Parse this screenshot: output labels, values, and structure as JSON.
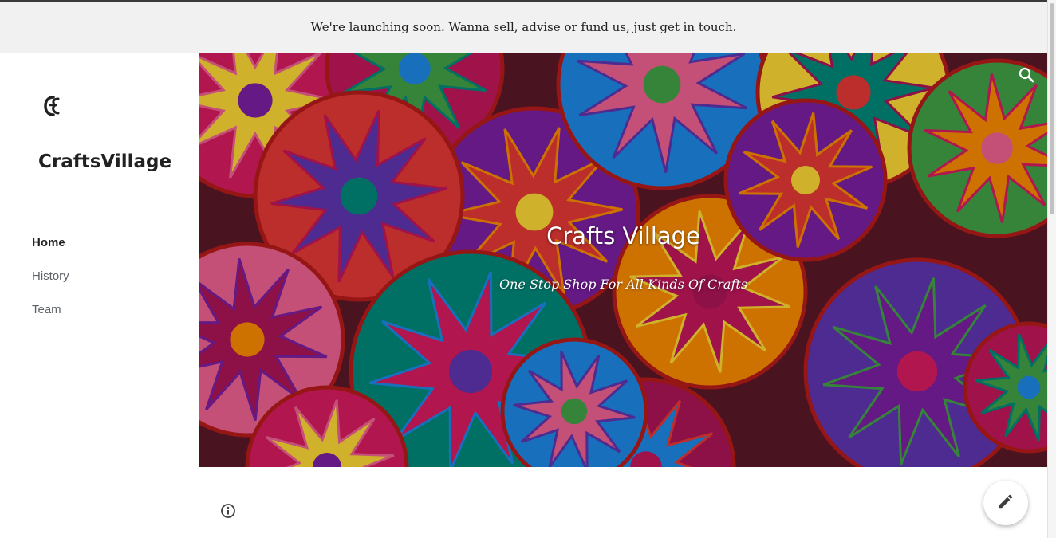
{
  "banner": {
    "text": "We're launching soon. Wanna sell, advise or fund us, just get in touch."
  },
  "sidebar": {
    "site_name": "CraftsVillage",
    "logo_icon": "crafts-village-logo",
    "nav": [
      {
        "label": "Home",
        "active": true
      },
      {
        "label": "History",
        "active": false
      },
      {
        "label": "Team",
        "active": false
      }
    ]
  },
  "hero": {
    "title": "Crafts Village",
    "subtitle": "One Stop Shop For All Kinds Of Crafts",
    "search_icon": "search-icon"
  },
  "footer": {
    "info_icon": "info-icon"
  },
  "fab": {
    "icon": "pencil-icon"
  },
  "colors": {
    "banner_bg": "#f1f1f1",
    "text_primary": "#212121",
    "nav_inactive": "#5f6368"
  }
}
